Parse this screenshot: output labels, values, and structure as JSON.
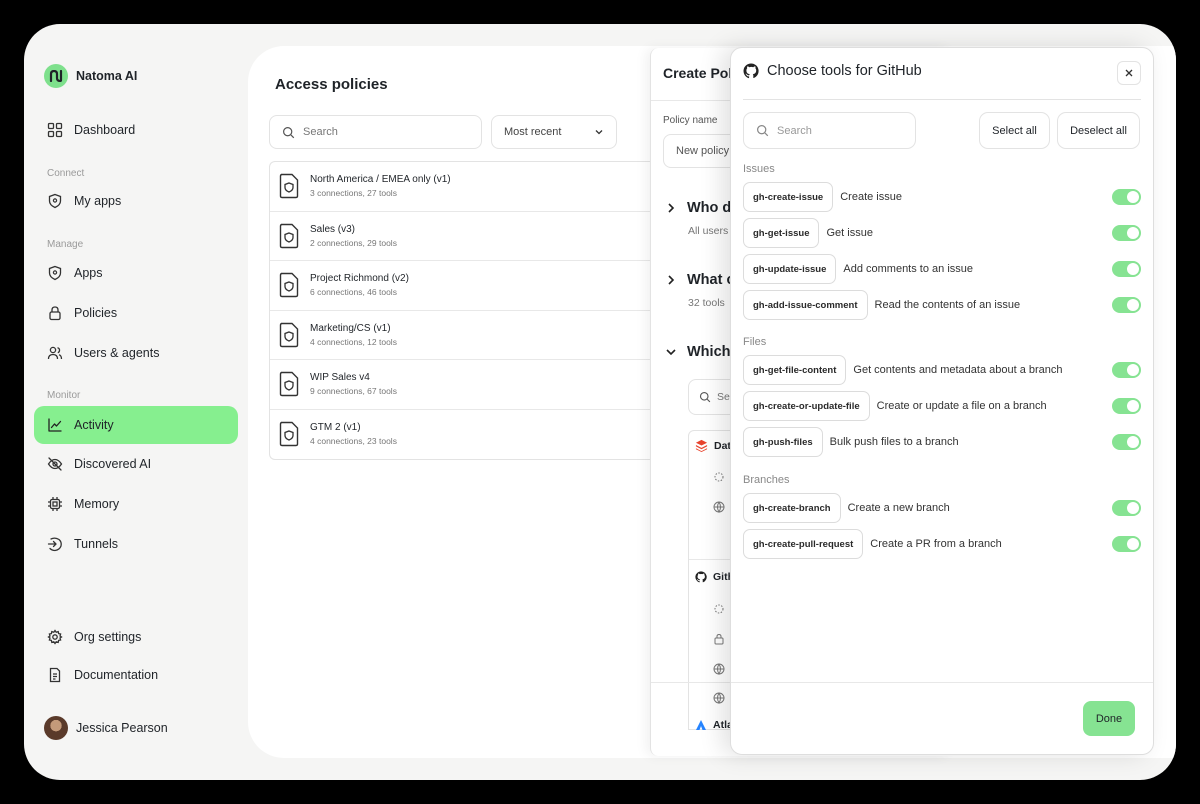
{
  "brand": {
    "name": "Natoma AI"
  },
  "sidebar": {
    "dashboard": "Dashboard",
    "section_connect": "Connect",
    "my_apps": "My apps",
    "section_manage": "Manage",
    "apps": "Apps",
    "policies": "Policies",
    "users_agents": "Users & agents",
    "section_monitor": "Monitor",
    "activity": "Activity",
    "discovered_ai": "Discovered AI",
    "memory": "Memory",
    "tunnels": "Tunnels",
    "org_settings": "Org settings",
    "documentation": "Documentation",
    "user_name": "Jessica Pearson",
    "active_item": "Activity"
  },
  "main": {
    "title": "Access policies",
    "search_placeholder": "Search",
    "sort_label": "Most recent",
    "policies": [
      {
        "name": "North America / EMEA only (v1)",
        "meta": "3 connections, 27 tools"
      },
      {
        "name": "Sales (v3)",
        "meta": "2 connections, 29 tools"
      },
      {
        "name": "Project Richmond (v2)",
        "meta": "6 connections, 46 tools"
      },
      {
        "name": "Marketing/CS (v1)",
        "meta": "4 connections, 12 tools"
      },
      {
        "name": "WIP Sales v4",
        "meta": "9 connections, 67 tools"
      },
      {
        "name": "GTM 2 (v1)",
        "meta": "4 connections, 23 tools"
      }
    ]
  },
  "create_policy": {
    "title": "Create Policy",
    "policy_name_label": "Policy name",
    "policy_name_value": "New policy",
    "who_title": "Who d",
    "who_sub": "All users",
    "what_title": "What c",
    "what_sub": "32 tools",
    "which_title": "Which",
    "search_placeholder": "Se",
    "apps": [
      "Dat",
      "Gith",
      "Atla"
    ]
  },
  "modal": {
    "title": "Choose tools for GitHub",
    "search_placeholder": "Search",
    "select_all": "Select all",
    "deselect_all": "Deselect all",
    "done": "Done",
    "groups": [
      {
        "name": "Issues",
        "tools": [
          {
            "id": "gh-create-issue",
            "desc": "Create issue",
            "enabled": true
          },
          {
            "id": "gh-get-issue",
            "desc": "Get issue",
            "enabled": true
          },
          {
            "id": "gh-update-issue",
            "desc": "Add comments to an issue",
            "enabled": true
          },
          {
            "id": "gh-add-issue-comment",
            "desc": "Read the contents of an issue",
            "enabled": true
          }
        ]
      },
      {
        "name": "Files",
        "tools": [
          {
            "id": "gh-get-file-content",
            "desc": "Get contents and metadata about a branch",
            "enabled": true
          },
          {
            "id": "gh-create-or-update-file",
            "desc": "Create or update a file on a branch",
            "enabled": true
          },
          {
            "id": "gh-push-files",
            "desc": "Bulk push files to a branch",
            "enabled": true
          }
        ]
      },
      {
        "name": "Branches",
        "tools": [
          {
            "id": "gh-create-branch",
            "desc": "Create a new branch",
            "enabled": true
          },
          {
            "id": "gh-create-pull-request",
            "desc": "Create a PR from a branch",
            "enabled": true
          }
        ]
      }
    ]
  },
  "colors": {
    "accent": "#86ef8f",
    "toggle_on": "#86e392"
  }
}
